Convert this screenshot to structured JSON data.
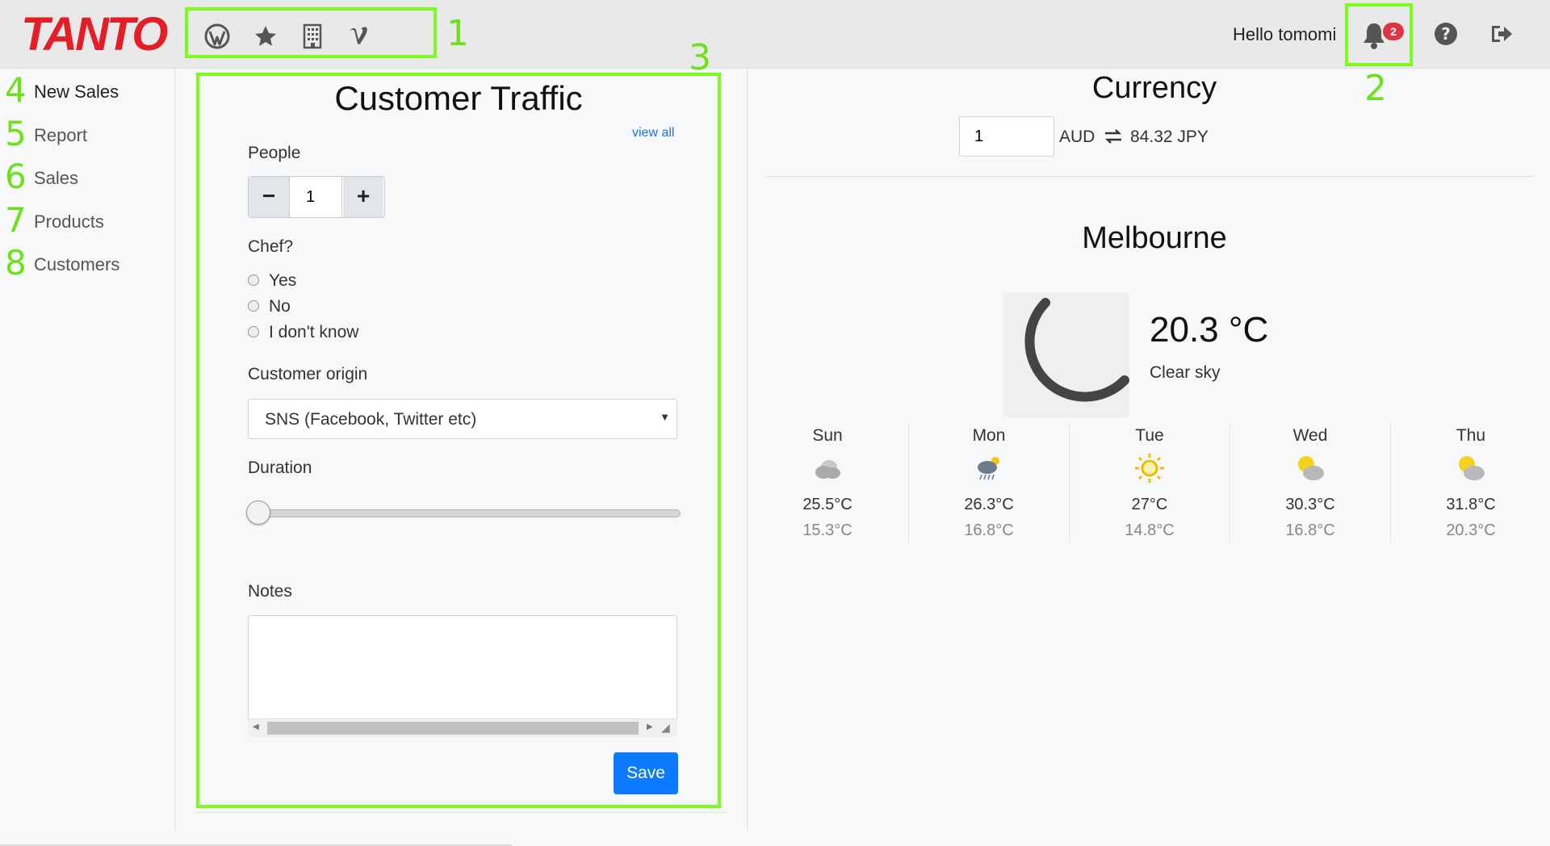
{
  "brand": {
    "logo_text": "TANTO",
    "color": "#e41e26"
  },
  "annotations": {
    "nav": "1",
    "notifications": "2",
    "form": "3"
  },
  "navbar": {
    "icons": [
      "wordpress-icon",
      "star-icon",
      "building-icon",
      "vimeo-icon"
    ],
    "greeting": "Hello tomomi",
    "notification_count": "2",
    "right_icons": [
      "bell-icon",
      "question-circle-icon",
      "sign-out-icon"
    ]
  },
  "sidebar": {
    "items": [
      {
        "num": "4",
        "label": "New Sales",
        "active": true
      },
      {
        "num": "5",
        "label": "Report"
      },
      {
        "num": "6",
        "label": "Sales"
      },
      {
        "num": "7",
        "label": "Products"
      },
      {
        "num": "8",
        "label": "Customers"
      }
    ]
  },
  "traffic": {
    "title": "Customer Traffic",
    "view_all": "view all",
    "people_label": "People",
    "people_value": "1",
    "minus_label": "−",
    "plus_label": "+",
    "chef_label": "Chef?",
    "chef_options": [
      "Yes",
      "No",
      "I don't know"
    ],
    "origin_label": "Customer origin",
    "origin_value": "SNS (Facebook, Twitter etc)",
    "duration_label": "Duration",
    "duration_value": 0,
    "notes_label": "Notes",
    "notes_value": "",
    "save_label": "Save"
  },
  "currency": {
    "title": "Currency",
    "amount": "1",
    "from": "AUD",
    "to": "84.32 JPY"
  },
  "weather": {
    "city": "Melbourne",
    "temp": "20.3",
    "unit": "°C",
    "condition": "Clear sky",
    "current_icon": "moon-icon",
    "forecast": [
      {
        "day": "Sun",
        "icon": "cloudy-icon",
        "hi": "25.5°C",
        "lo": "15.3°C"
      },
      {
        "day": "Mon",
        "icon": "rain-sun-cloud-icon",
        "hi": "26.3°C",
        "lo": "16.8°C"
      },
      {
        "day": "Tue",
        "icon": "sun-icon",
        "hi": "27°C",
        "lo": "14.8°C"
      },
      {
        "day": "Wed",
        "icon": "partly-cloudy-icon",
        "hi": "30.3°C",
        "lo": "16.8°C"
      },
      {
        "day": "Thu",
        "icon": "partly-cloudy-icon",
        "hi": "31.8°C",
        "lo": "20.3°C"
      }
    ]
  },
  "colors": {
    "accent": "#0d7bff",
    "annotation": "#7cfc1e",
    "badge": "#dc3545"
  }
}
